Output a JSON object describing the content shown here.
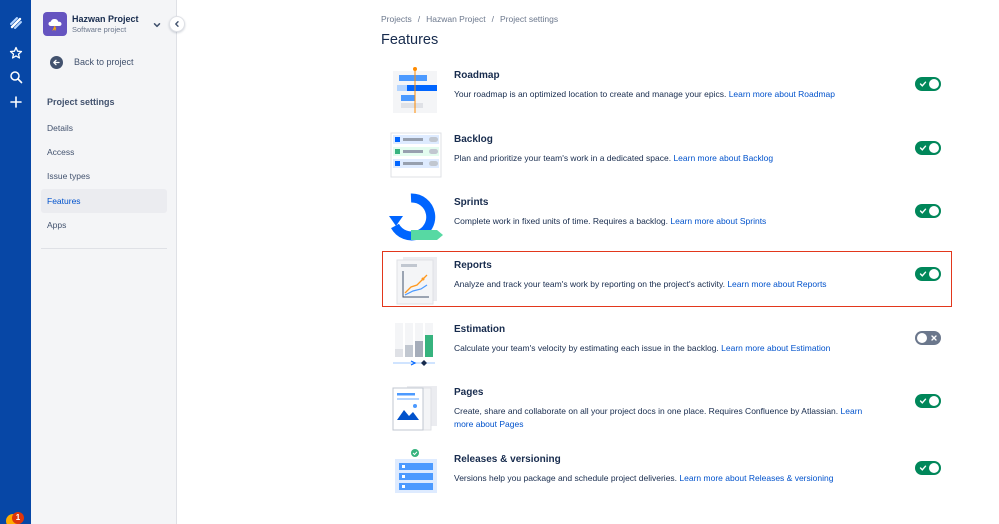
{
  "sidebar": {
    "project_name": "Hazwan Project",
    "project_type": "Software project",
    "back_label": "Back to project",
    "heading": "Project settings",
    "items": [
      {
        "label": "Details",
        "active": false
      },
      {
        "label": "Access",
        "active": false
      },
      {
        "label": "Issue types",
        "active": false
      },
      {
        "label": "Features",
        "active": true
      },
      {
        "label": "Apps",
        "active": false
      }
    ]
  },
  "rail": {
    "icons": [
      "jira-logo-icon",
      "star-icon",
      "search-icon",
      "plus-icon"
    ],
    "notification_count": "1"
  },
  "breadcrumb": [
    "Projects",
    "Hazwan Project",
    "Project settings"
  ],
  "breadcrumb_sep": "/",
  "page_title": "Features",
  "features": [
    {
      "title": "Roadmap",
      "desc": "Your roadmap is an optimized location to create and manage your epics. ",
      "link": "Learn more about Roadmap",
      "enabled": true,
      "icon": "roadmap-illustration-icon"
    },
    {
      "title": "Backlog",
      "desc": "Plan and prioritize your team's work in a dedicated space. ",
      "link": "Learn more about Backlog",
      "enabled": true,
      "icon": "backlog-illustration-icon"
    },
    {
      "title": "Sprints",
      "desc": "Complete work in fixed units of time. Requires a backlog. ",
      "link": "Learn more about Sprints",
      "enabled": true,
      "icon": "sprints-illustration-icon"
    },
    {
      "title": "Reports",
      "desc": "Analyze and track your team's work by reporting on the project's activity. ",
      "link": "Learn more about Reports",
      "enabled": true,
      "icon": "reports-illustration-icon"
    },
    {
      "title": "Estimation",
      "desc": "Calculate your team's velocity by estimating each issue in the backlog. ",
      "link": "Learn more about Estimation",
      "enabled": false,
      "icon": "estimation-illustration-icon"
    },
    {
      "title": "Pages",
      "desc": "Create, share and collaborate on all your project docs in one place. Requires Confluence by Atlassian. ",
      "link": "Learn more about Pages",
      "enabled": true,
      "icon": "pages-illustration-icon"
    },
    {
      "title": "Releases & versioning",
      "desc": "Versions help you package and schedule project deliveries. ",
      "link": "Learn more about Releases & versioning",
      "enabled": true,
      "icon": "releases-illustration-icon"
    }
  ],
  "colors": {
    "rail": "#0747a6",
    "toggle_on": "#00875a",
    "toggle_off": "#6b778c",
    "link": "#0052cc",
    "highlight": "#e2371c"
  }
}
